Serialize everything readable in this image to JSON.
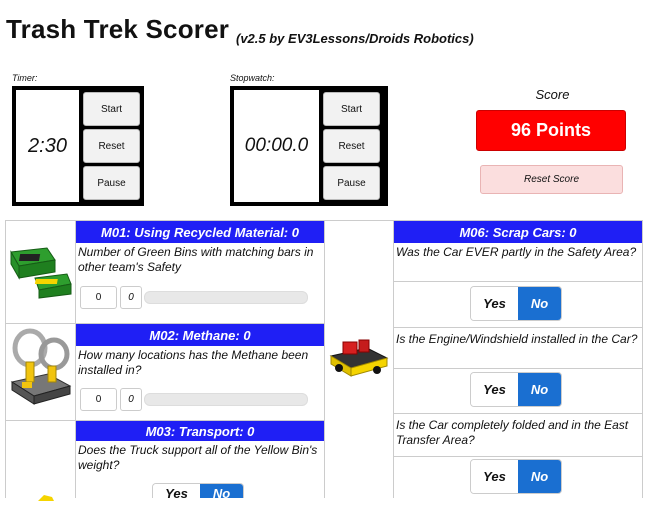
{
  "header": {
    "title": "Trash Trek Scorer",
    "subtitle": "(v2.5 by EV3Lessons/Droids Robotics)"
  },
  "timer": {
    "label": "Timer:",
    "display": "2:30",
    "start": "Start",
    "reset": "Reset",
    "pause": "Pause"
  },
  "stopwatch": {
    "label": "Stopwatch:",
    "display": "00:00.0",
    "start": "Start",
    "reset": "Reset",
    "pause": "Pause"
  },
  "score": {
    "label": "Score",
    "value": "96 Points",
    "reset_label": "Reset Score"
  },
  "missions": {
    "m01": {
      "title": "M01: Using Recycled Material: 0",
      "question": "Number of Green Bins with matching bars in other team's Safety",
      "count": "0",
      "slider_value": "0"
    },
    "m02": {
      "title": "M02: Methane: 0",
      "question": "How many locations has the Methane been installed in?",
      "count": "0",
      "slider_value": "0"
    },
    "m03": {
      "title": "M03: Transport: 0",
      "question": "Does the Truck support all of the Yellow Bin's weight?",
      "yes": "Yes",
      "no": "No"
    },
    "m06": {
      "title": "M06: Scrap Cars: 0",
      "q1": "Was the Car EVER partly in the Safety Area?",
      "q2": "Is the Engine/Windshield installed in the Car?",
      "q3": "Is the Car completely folded and in the East Transfer Area?",
      "yes": "Yes",
      "no": "No"
    }
  },
  "colors": {
    "mission_header": "#1f1ff5",
    "score_red": "#ff0000",
    "no_blue": "#1a6fd1"
  }
}
